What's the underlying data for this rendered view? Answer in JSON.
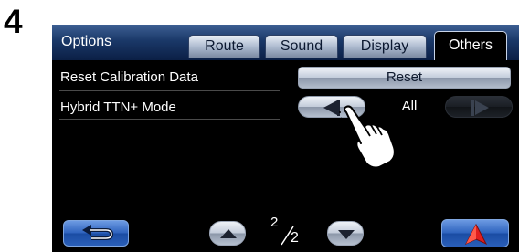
{
  "step": {
    "number": "4"
  },
  "header": {
    "title": "Options",
    "tabs": [
      {
        "label": "Route",
        "active": false
      },
      {
        "label": "Sound",
        "active": false
      },
      {
        "label": "Display",
        "active": false
      },
      {
        "label": "Others",
        "active": true
      }
    ]
  },
  "settings": [
    {
      "label": "Reset Calibration Data",
      "control": "button",
      "button_label": "Reset"
    },
    {
      "label": "Hybrid TTN+ Mode",
      "control": "selector",
      "value": "All"
    }
  ],
  "pagination": {
    "current": "2",
    "total": "2"
  },
  "icons": {
    "back": "back-arrow-icon",
    "page_up": "triangle-up-icon",
    "page_down": "triangle-down-icon",
    "map": "navigation-arrow-icon",
    "previous_value": "triangle-left-icon",
    "next_value": "triangle-right-icon",
    "pointer": "pointing-hand-icon"
  },
  "colors": {
    "header_blue": "#1a3868",
    "button_blue": "#2d62bd",
    "map_arrow_red": "#e01e1e",
    "screen_background": "#000000"
  }
}
